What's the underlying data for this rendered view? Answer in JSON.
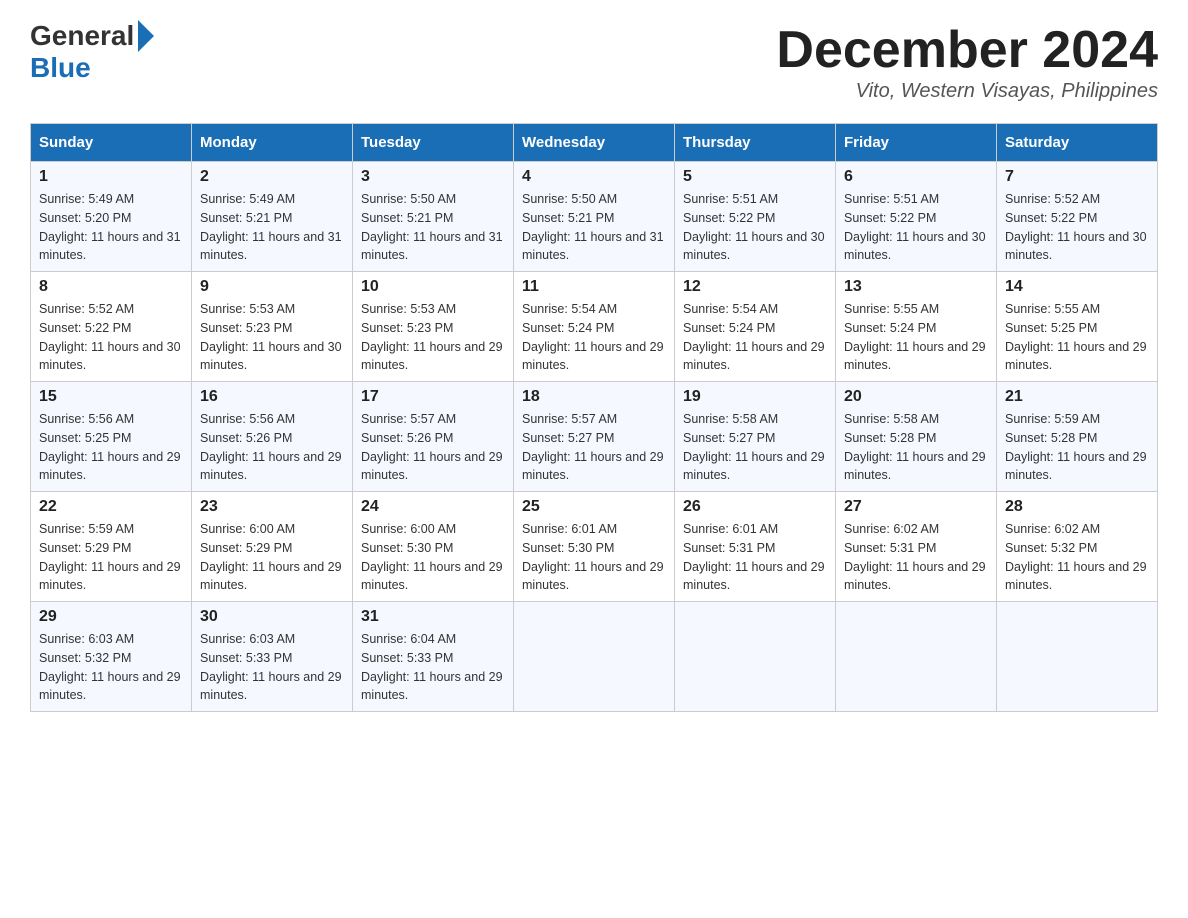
{
  "header": {
    "logo_general": "General",
    "logo_blue": "Blue",
    "month_title": "December 2024",
    "location": "Vito, Western Visayas, Philippines"
  },
  "days_of_week": [
    "Sunday",
    "Monday",
    "Tuesday",
    "Wednesday",
    "Thursday",
    "Friday",
    "Saturday"
  ],
  "weeks": [
    [
      {
        "day": "1",
        "sunrise": "5:49 AM",
        "sunset": "5:20 PM",
        "daylight": "11 hours and 31 minutes."
      },
      {
        "day": "2",
        "sunrise": "5:49 AM",
        "sunset": "5:21 PM",
        "daylight": "11 hours and 31 minutes."
      },
      {
        "day": "3",
        "sunrise": "5:50 AM",
        "sunset": "5:21 PM",
        "daylight": "11 hours and 31 minutes."
      },
      {
        "day": "4",
        "sunrise": "5:50 AM",
        "sunset": "5:21 PM",
        "daylight": "11 hours and 31 minutes."
      },
      {
        "day": "5",
        "sunrise": "5:51 AM",
        "sunset": "5:22 PM",
        "daylight": "11 hours and 30 minutes."
      },
      {
        "day": "6",
        "sunrise": "5:51 AM",
        "sunset": "5:22 PM",
        "daylight": "11 hours and 30 minutes."
      },
      {
        "day": "7",
        "sunrise": "5:52 AM",
        "sunset": "5:22 PM",
        "daylight": "11 hours and 30 minutes."
      }
    ],
    [
      {
        "day": "8",
        "sunrise": "5:52 AM",
        "sunset": "5:22 PM",
        "daylight": "11 hours and 30 minutes."
      },
      {
        "day": "9",
        "sunrise": "5:53 AM",
        "sunset": "5:23 PM",
        "daylight": "11 hours and 30 minutes."
      },
      {
        "day": "10",
        "sunrise": "5:53 AM",
        "sunset": "5:23 PM",
        "daylight": "11 hours and 29 minutes."
      },
      {
        "day": "11",
        "sunrise": "5:54 AM",
        "sunset": "5:24 PM",
        "daylight": "11 hours and 29 minutes."
      },
      {
        "day": "12",
        "sunrise": "5:54 AM",
        "sunset": "5:24 PM",
        "daylight": "11 hours and 29 minutes."
      },
      {
        "day": "13",
        "sunrise": "5:55 AM",
        "sunset": "5:24 PM",
        "daylight": "11 hours and 29 minutes."
      },
      {
        "day": "14",
        "sunrise": "5:55 AM",
        "sunset": "5:25 PM",
        "daylight": "11 hours and 29 minutes."
      }
    ],
    [
      {
        "day": "15",
        "sunrise": "5:56 AM",
        "sunset": "5:25 PM",
        "daylight": "11 hours and 29 minutes."
      },
      {
        "day": "16",
        "sunrise": "5:56 AM",
        "sunset": "5:26 PM",
        "daylight": "11 hours and 29 minutes."
      },
      {
        "day": "17",
        "sunrise": "5:57 AM",
        "sunset": "5:26 PM",
        "daylight": "11 hours and 29 minutes."
      },
      {
        "day": "18",
        "sunrise": "5:57 AM",
        "sunset": "5:27 PM",
        "daylight": "11 hours and 29 minutes."
      },
      {
        "day": "19",
        "sunrise": "5:58 AM",
        "sunset": "5:27 PM",
        "daylight": "11 hours and 29 minutes."
      },
      {
        "day": "20",
        "sunrise": "5:58 AM",
        "sunset": "5:28 PM",
        "daylight": "11 hours and 29 minutes."
      },
      {
        "day": "21",
        "sunrise": "5:59 AM",
        "sunset": "5:28 PM",
        "daylight": "11 hours and 29 minutes."
      }
    ],
    [
      {
        "day": "22",
        "sunrise": "5:59 AM",
        "sunset": "5:29 PM",
        "daylight": "11 hours and 29 minutes."
      },
      {
        "day": "23",
        "sunrise": "6:00 AM",
        "sunset": "5:29 PM",
        "daylight": "11 hours and 29 minutes."
      },
      {
        "day": "24",
        "sunrise": "6:00 AM",
        "sunset": "5:30 PM",
        "daylight": "11 hours and 29 minutes."
      },
      {
        "day": "25",
        "sunrise": "6:01 AM",
        "sunset": "5:30 PM",
        "daylight": "11 hours and 29 minutes."
      },
      {
        "day": "26",
        "sunrise": "6:01 AM",
        "sunset": "5:31 PM",
        "daylight": "11 hours and 29 minutes."
      },
      {
        "day": "27",
        "sunrise": "6:02 AM",
        "sunset": "5:31 PM",
        "daylight": "11 hours and 29 minutes."
      },
      {
        "day": "28",
        "sunrise": "6:02 AM",
        "sunset": "5:32 PM",
        "daylight": "11 hours and 29 minutes."
      }
    ],
    [
      {
        "day": "29",
        "sunrise": "6:03 AM",
        "sunset": "5:32 PM",
        "daylight": "11 hours and 29 minutes."
      },
      {
        "day": "30",
        "sunrise": "6:03 AM",
        "sunset": "5:33 PM",
        "daylight": "11 hours and 29 minutes."
      },
      {
        "day": "31",
        "sunrise": "6:04 AM",
        "sunset": "5:33 PM",
        "daylight": "11 hours and 29 minutes."
      },
      null,
      null,
      null,
      null
    ]
  ]
}
